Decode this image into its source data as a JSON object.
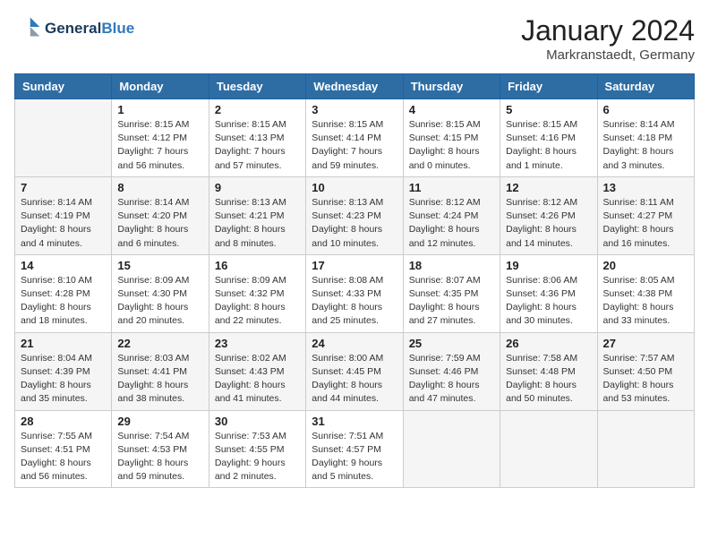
{
  "header": {
    "logo_line1": "General",
    "logo_line2": "Blue",
    "month": "January 2024",
    "location": "Markranstaedt, Germany"
  },
  "weekdays": [
    "Sunday",
    "Monday",
    "Tuesday",
    "Wednesday",
    "Thursday",
    "Friday",
    "Saturday"
  ],
  "weeks": [
    [
      {
        "num": "",
        "info": ""
      },
      {
        "num": "1",
        "info": "Sunrise: 8:15 AM\nSunset: 4:12 PM\nDaylight: 7 hours\nand 56 minutes."
      },
      {
        "num": "2",
        "info": "Sunrise: 8:15 AM\nSunset: 4:13 PM\nDaylight: 7 hours\nand 57 minutes."
      },
      {
        "num": "3",
        "info": "Sunrise: 8:15 AM\nSunset: 4:14 PM\nDaylight: 7 hours\nand 59 minutes."
      },
      {
        "num": "4",
        "info": "Sunrise: 8:15 AM\nSunset: 4:15 PM\nDaylight: 8 hours\nand 0 minutes."
      },
      {
        "num": "5",
        "info": "Sunrise: 8:15 AM\nSunset: 4:16 PM\nDaylight: 8 hours\nand 1 minute."
      },
      {
        "num": "6",
        "info": "Sunrise: 8:14 AM\nSunset: 4:18 PM\nDaylight: 8 hours\nand 3 minutes."
      }
    ],
    [
      {
        "num": "7",
        "info": "Sunrise: 8:14 AM\nSunset: 4:19 PM\nDaylight: 8 hours\nand 4 minutes."
      },
      {
        "num": "8",
        "info": "Sunrise: 8:14 AM\nSunset: 4:20 PM\nDaylight: 8 hours\nand 6 minutes."
      },
      {
        "num": "9",
        "info": "Sunrise: 8:13 AM\nSunset: 4:21 PM\nDaylight: 8 hours\nand 8 minutes."
      },
      {
        "num": "10",
        "info": "Sunrise: 8:13 AM\nSunset: 4:23 PM\nDaylight: 8 hours\nand 10 minutes."
      },
      {
        "num": "11",
        "info": "Sunrise: 8:12 AM\nSunset: 4:24 PM\nDaylight: 8 hours\nand 12 minutes."
      },
      {
        "num": "12",
        "info": "Sunrise: 8:12 AM\nSunset: 4:26 PM\nDaylight: 8 hours\nand 14 minutes."
      },
      {
        "num": "13",
        "info": "Sunrise: 8:11 AM\nSunset: 4:27 PM\nDaylight: 8 hours\nand 16 minutes."
      }
    ],
    [
      {
        "num": "14",
        "info": "Sunrise: 8:10 AM\nSunset: 4:28 PM\nDaylight: 8 hours\nand 18 minutes."
      },
      {
        "num": "15",
        "info": "Sunrise: 8:09 AM\nSunset: 4:30 PM\nDaylight: 8 hours\nand 20 minutes."
      },
      {
        "num": "16",
        "info": "Sunrise: 8:09 AM\nSunset: 4:32 PM\nDaylight: 8 hours\nand 22 minutes."
      },
      {
        "num": "17",
        "info": "Sunrise: 8:08 AM\nSunset: 4:33 PM\nDaylight: 8 hours\nand 25 minutes."
      },
      {
        "num": "18",
        "info": "Sunrise: 8:07 AM\nSunset: 4:35 PM\nDaylight: 8 hours\nand 27 minutes."
      },
      {
        "num": "19",
        "info": "Sunrise: 8:06 AM\nSunset: 4:36 PM\nDaylight: 8 hours\nand 30 minutes."
      },
      {
        "num": "20",
        "info": "Sunrise: 8:05 AM\nSunset: 4:38 PM\nDaylight: 8 hours\nand 33 minutes."
      }
    ],
    [
      {
        "num": "21",
        "info": "Sunrise: 8:04 AM\nSunset: 4:39 PM\nDaylight: 8 hours\nand 35 minutes."
      },
      {
        "num": "22",
        "info": "Sunrise: 8:03 AM\nSunset: 4:41 PM\nDaylight: 8 hours\nand 38 minutes."
      },
      {
        "num": "23",
        "info": "Sunrise: 8:02 AM\nSunset: 4:43 PM\nDaylight: 8 hours\nand 41 minutes."
      },
      {
        "num": "24",
        "info": "Sunrise: 8:00 AM\nSunset: 4:45 PM\nDaylight: 8 hours\nand 44 minutes."
      },
      {
        "num": "25",
        "info": "Sunrise: 7:59 AM\nSunset: 4:46 PM\nDaylight: 8 hours\nand 47 minutes."
      },
      {
        "num": "26",
        "info": "Sunrise: 7:58 AM\nSunset: 4:48 PM\nDaylight: 8 hours\nand 50 minutes."
      },
      {
        "num": "27",
        "info": "Sunrise: 7:57 AM\nSunset: 4:50 PM\nDaylight: 8 hours\nand 53 minutes."
      }
    ],
    [
      {
        "num": "28",
        "info": "Sunrise: 7:55 AM\nSunset: 4:51 PM\nDaylight: 8 hours\nand 56 minutes."
      },
      {
        "num": "29",
        "info": "Sunrise: 7:54 AM\nSunset: 4:53 PM\nDaylight: 8 hours\nand 59 minutes."
      },
      {
        "num": "30",
        "info": "Sunrise: 7:53 AM\nSunset: 4:55 PM\nDaylight: 9 hours\nand 2 minutes."
      },
      {
        "num": "31",
        "info": "Sunrise: 7:51 AM\nSunset: 4:57 PM\nDaylight: 9 hours\nand 5 minutes."
      },
      {
        "num": "",
        "info": ""
      },
      {
        "num": "",
        "info": ""
      },
      {
        "num": "",
        "info": ""
      }
    ]
  ]
}
